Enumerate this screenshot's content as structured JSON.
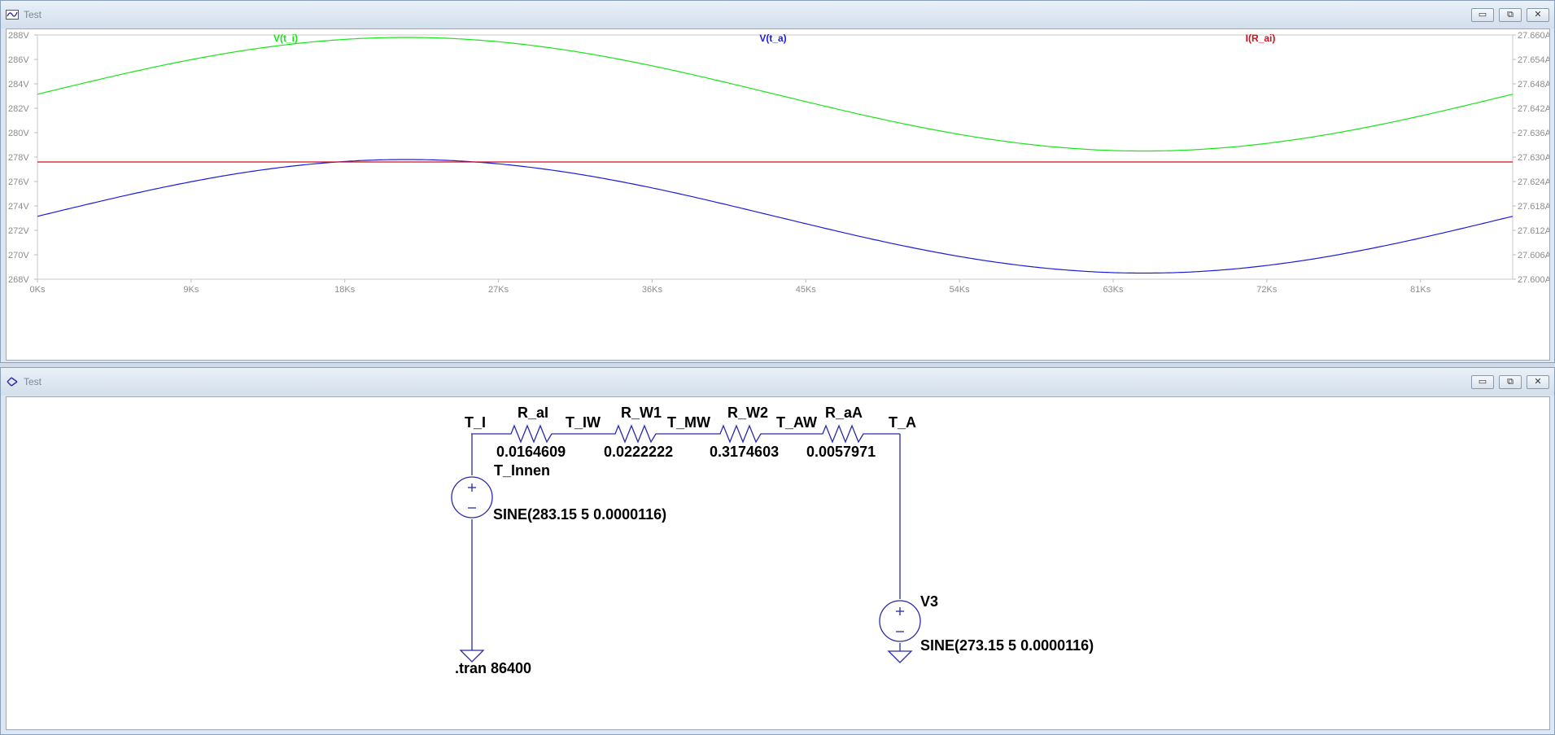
{
  "plot_window": {
    "title": "Test",
    "buttons": {
      "minimize": "▭",
      "maximize": "⧉",
      "close": "✕"
    }
  },
  "schematic_window": {
    "title": "Test",
    "buttons": {
      "minimize": "▭",
      "maximize": "⧉",
      "close": "✕"
    }
  },
  "colors": {
    "v_ti": "#18e418",
    "v_ta": "#1c1cd8",
    "i_rai": "#cc1020",
    "wire": "#2a2aa8",
    "axis_text": "#8c8c8c"
  },
  "chart_data": {
    "type": "line",
    "x_unit": "Ks",
    "x_ticks": [
      "0Ks",
      "9Ks",
      "18Ks",
      "27Ks",
      "36Ks",
      "45Ks",
      "54Ks",
      "63Ks",
      "72Ks",
      "81Ks"
    ],
    "xlim": [
      0,
      86.4
    ],
    "y_left_ticks": [
      "288V",
      "286V",
      "284V",
      "282V",
      "280V",
      "278V",
      "276V",
      "274V",
      "272V",
      "270V",
      "268V"
    ],
    "ylim_left": [
      268,
      288
    ],
    "y_right_ticks": [
      "27.660A",
      "27.654A",
      "27.648A",
      "27.642A",
      "27.636A",
      "27.630A",
      "27.624A",
      "27.618A",
      "27.612A",
      "27.606A",
      "27.600A"
    ],
    "ylim_right": [
      27.6,
      27.66
    ],
    "series": [
      {
        "name": "V(t_i)",
        "axis": "left",
        "offset": 283.15,
        "amplitude": 4.65
      },
      {
        "name": "V(t_a)",
        "axis": "left",
        "offset": 273.15,
        "amplitude": 4.65
      },
      {
        "name": "I(R_ai)",
        "axis": "right",
        "constant": 27.6288
      }
    ]
  },
  "schematic": {
    "nodes": [
      "T_I",
      "T_IW",
      "T_MW",
      "T_AW",
      "T_A"
    ],
    "resistors": [
      {
        "name": "R_aI",
        "value": "0.0164609"
      },
      {
        "name": "R_W1",
        "value": "0.0222222"
      },
      {
        "name": "R_W2",
        "value": "0.3174603"
      },
      {
        "name": "R_aA",
        "value": "0.0057971"
      }
    ],
    "source_inner": {
      "name": "T_Innen",
      "value": "SINE(283.15 5 0.0000116)"
    },
    "source_outer": {
      "name": "V3",
      "value": "SINE(273.15 5 0.0000116)"
    },
    "directive": ".tran 86400"
  }
}
